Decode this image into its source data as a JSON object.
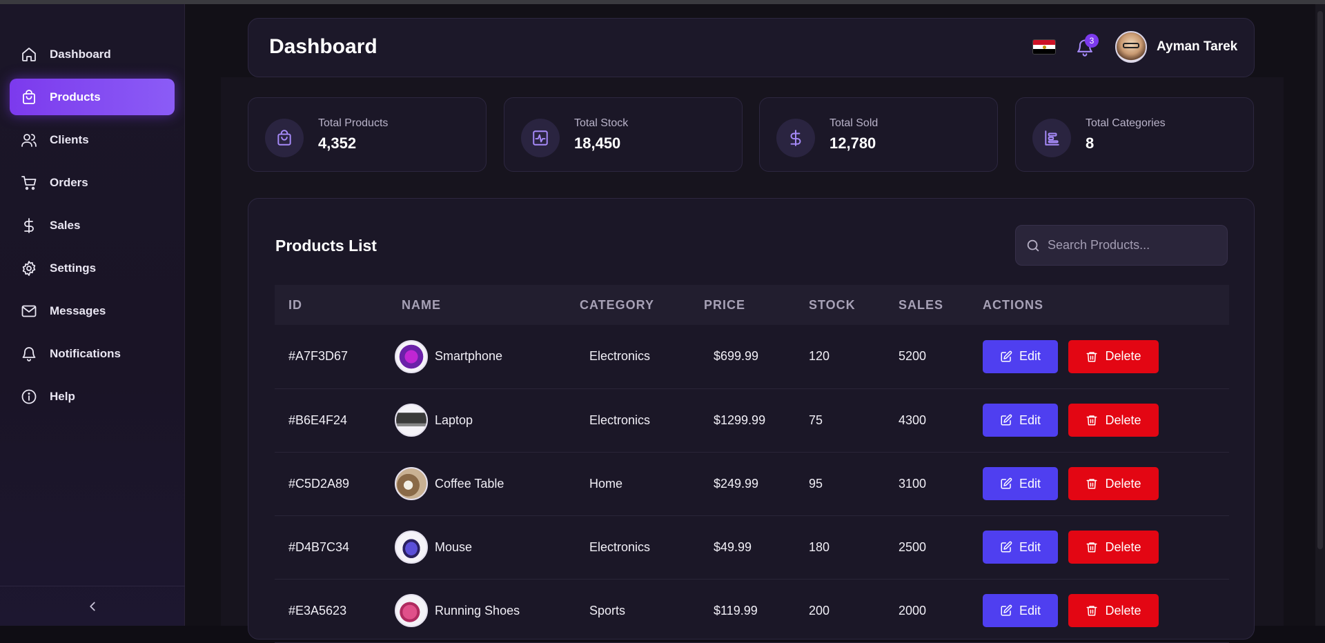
{
  "sidebar": {
    "items": [
      {
        "label": "Dashboard",
        "icon": "home-icon",
        "active": false
      },
      {
        "label": "Products",
        "icon": "shopping-bag-icon",
        "active": true
      },
      {
        "label": "Clients",
        "icon": "users-icon",
        "active": false
      },
      {
        "label": "Orders",
        "icon": "cart-icon",
        "active": false
      },
      {
        "label": "Sales",
        "icon": "dollar-icon",
        "active": false
      },
      {
        "label": "Settings",
        "icon": "gear-icon",
        "active": false
      },
      {
        "label": "Messages",
        "icon": "mail-icon",
        "active": false
      },
      {
        "label": "Notifications",
        "icon": "bell-icon",
        "active": false
      },
      {
        "label": "Help",
        "icon": "info-icon",
        "active": false
      }
    ],
    "collapse_icon": "chevron-left-icon"
  },
  "header": {
    "title": "Dashboard",
    "notification_count": "3",
    "user_name": "Ayman Tarek",
    "flag_icon": "egypt-flag-icon"
  },
  "stats": [
    {
      "label": "Total Products",
      "value": "4,352",
      "icon": "shopping-bag-icon"
    },
    {
      "label": "Total Stock",
      "value": "18,450",
      "icon": "activity-icon"
    },
    {
      "label": "Total Sold",
      "value": "12,780",
      "icon": "dollar-icon"
    },
    {
      "label": "Total Categories",
      "value": "8",
      "icon": "categories-icon"
    }
  ],
  "products": {
    "title": "Products List",
    "search_placeholder": "Search Products...",
    "columns": [
      "ID",
      "NAME",
      "CATEGORY",
      "PRICE",
      "STOCK",
      "SALES",
      "ACTIONS"
    ],
    "edit_label": "Edit",
    "delete_label": "Delete",
    "rows": [
      {
        "id": "#A7F3D67",
        "name": "Smartphone",
        "category": "Electronics",
        "price": "$699.99",
        "stock": "120",
        "sales": "5200"
      },
      {
        "id": "#B6E4F24",
        "name": "Laptop",
        "category": "Electronics",
        "price": "$1299.99",
        "stock": "75",
        "sales": "4300"
      },
      {
        "id": "#C5D2A89",
        "name": "Coffee Table",
        "category": "Home",
        "price": "$249.99",
        "stock": "95",
        "sales": "3100"
      },
      {
        "id": "#D4B7C34",
        "name": "Mouse",
        "category": "Electronics",
        "price": "$49.99",
        "stock": "180",
        "sales": "2500"
      },
      {
        "id": "#E3A5623",
        "name": "Running Shoes",
        "category": "Sports",
        "price": "$119.99",
        "stock": "200",
        "sales": "2000"
      }
    ]
  },
  "colors": {
    "accent": "#7c3aed",
    "edit": "#4f3ff0",
    "delete": "#e30613"
  }
}
